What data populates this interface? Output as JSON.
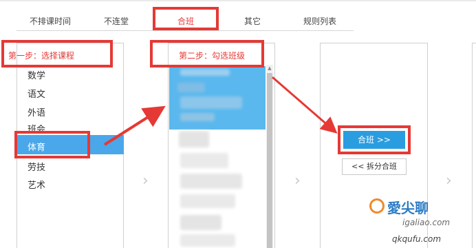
{
  "tabs": [
    {
      "label": "不排课时间"
    },
    {
      "label": "不连堂"
    },
    {
      "label": "合班",
      "active": true
    },
    {
      "label": "其它"
    },
    {
      "label": "规则列表"
    }
  ],
  "annotations": {
    "step1": "第一步：选择课程",
    "step2": "第二步：勾选班级"
  },
  "courses": {
    "items": [
      "数学",
      "语文",
      "外语",
      "班会",
      "体育",
      "劳技",
      "艺术"
    ],
    "selected": "体育"
  },
  "actions": {
    "merge_label": "合班 >>",
    "split_label": "<< 拆分合班"
  },
  "navigation": {
    "chevron": "›"
  },
  "watermark": {
    "brand_top": "愛尖聊",
    "url_top": "igaliao.com",
    "url_bottom": "qkqufu.com"
  },
  "colors": {
    "annotation_red": "#e53935",
    "selection_blue": "#4aa7ea",
    "button_blue": "#2a9de0"
  }
}
